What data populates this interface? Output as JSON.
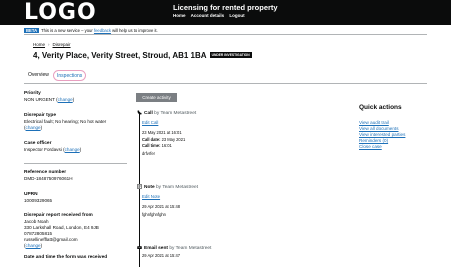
{
  "header": {
    "logo": "LOGO",
    "service_name": "Licensing for rented property",
    "nav": [
      "Home",
      "Account details",
      "Logout"
    ]
  },
  "beta_banner": {
    "tag": "BETA",
    "text_before": "This is a new service – your ",
    "link": "feedback",
    "text_after": " will help us to improve it."
  },
  "breadcrumb": [
    "Home",
    "Disrepair"
  ],
  "page": {
    "title": "4, Verity Place, Verity Street, Stroud, AB1 1BA",
    "status": "UNDER INVESTIGATION"
  },
  "tabs": [
    "Overview",
    "Inspections"
  ],
  "details": {
    "priority_label": "Priority",
    "priority_value": "NON URGENT",
    "priority_change": "change",
    "disrepair_label": "Disrepair type",
    "disrepair_value": "Electrical fault; No hearing; No hot water",
    "disrepair_change": "change",
    "officer_label": "Case officer",
    "officer_value": "Inspector Fordavsi",
    "officer_change": "change",
    "ref_label": "Reference number",
    "ref_value": "DMD-1848750976061H",
    "uprn_label": "UPRN",
    "uprn_value": "10009329065",
    "report_label": "Disrepair report received from",
    "report_name": "Jacob Noah",
    "report_address": "330 Larkshall Road, London, E4 9JB",
    "report_phone": "07872805815",
    "report_email": "russellinefflatt@gmail.com",
    "report_change": "change",
    "date_label": "Date and time the form was received"
  },
  "actions": {
    "create_activity": "Create activity"
  },
  "timeline": [
    {
      "type": "Call",
      "by": "by Team Metastreet",
      "link": "Edit Call",
      "timestamp": "23 May 2021 at 16:01",
      "call_date_label": "Call date:",
      "call_date": "23 May 2021",
      "call_time_label": "Call time:",
      "call_time": "16:01",
      "note": "drfvrfer"
    },
    {
      "type": "Note",
      "by": "by Team Metastreet",
      "link": "Edit Note",
      "timestamp": "29 Apr 2021 at 15:48",
      "note": "fghnfghnfghn"
    },
    {
      "type": "Email sent",
      "by": "by Team Metastreet",
      "timestamp": "29 Apr 2021 at 15:47"
    }
  ],
  "quick_actions": {
    "title": "Quick actions",
    "items": [
      "View audit trail",
      "View all documents",
      "View interested parties",
      "Reminders (0)",
      "Close case"
    ]
  }
}
